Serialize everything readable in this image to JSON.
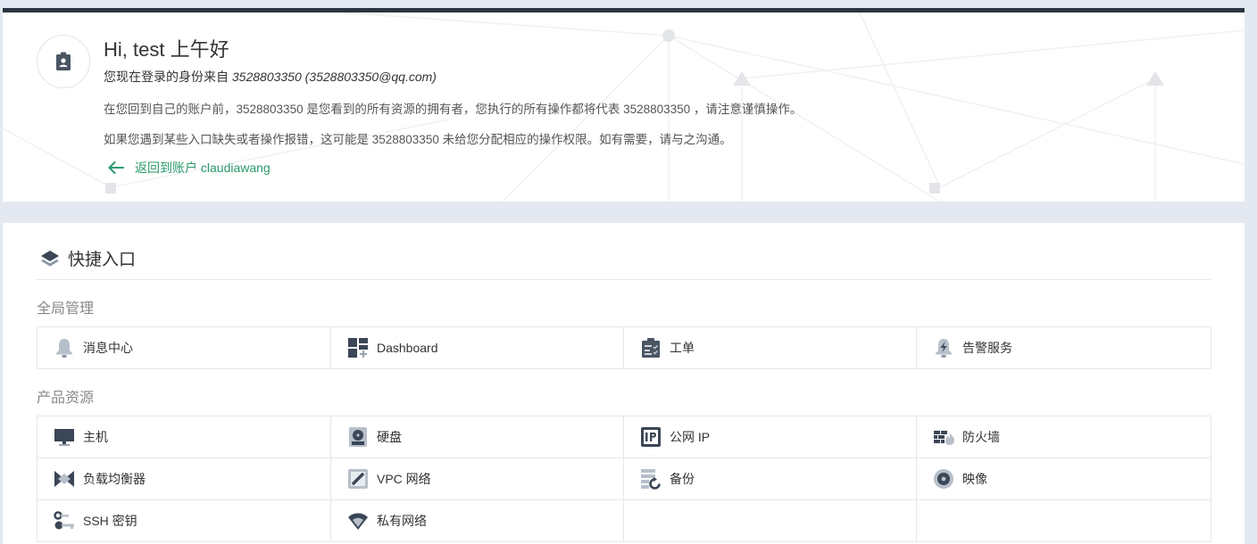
{
  "header": {
    "greeting": "Hi, test 上午好",
    "identity_prefix": "您现在登录的身份来自",
    "identity_account": "3528803350 (3528803350@qq.com)",
    "info_line1": "在您回到自己的账户前，3528803350 是您看到的所有资源的拥有者，您执行的所有操作都将代表 3528803350 ，请注意谨慎操作。",
    "info_line2": "如果您遇到某些入口缺失或者操作报错，这可能是 3528803350 未给您分配相应的操作权限。如有需要，请与之沟通。",
    "back_link": "返回到账户 claudiawang"
  },
  "quick_entry": {
    "title": "快捷入口",
    "groups": [
      {
        "title": "全局管理",
        "items": [
          {
            "label": "消息中心",
            "icon": "bell-icon"
          },
          {
            "label": "Dashboard",
            "icon": "dashboard-icon"
          },
          {
            "label": "工单",
            "icon": "ticket-icon"
          },
          {
            "label": "告警服务",
            "icon": "alarm-icon"
          }
        ]
      },
      {
        "title": "产品资源",
        "items": [
          {
            "label": "主机",
            "icon": "monitor-icon"
          },
          {
            "label": "硬盘",
            "icon": "disk-icon"
          },
          {
            "label": "公网 IP",
            "icon": "ip-icon"
          },
          {
            "label": "防火墙",
            "icon": "firewall-icon"
          },
          {
            "label": "负载均衡器",
            "icon": "load-balancer-icon"
          },
          {
            "label": "VPC 网络",
            "icon": "vpc-icon"
          },
          {
            "label": "备份",
            "icon": "backup-icon"
          },
          {
            "label": "映像",
            "icon": "image-icon"
          },
          {
            "label": "SSH 密钥",
            "icon": "ssh-key-icon"
          },
          {
            "label": "私有网络",
            "icon": "private-network-icon"
          }
        ]
      }
    ]
  },
  "colors": {
    "accent_green": "#2a9a6b",
    "header_bar": "#2b3441",
    "icon_dark": "#3b4656",
    "page_bg": "#e4e9f1"
  }
}
